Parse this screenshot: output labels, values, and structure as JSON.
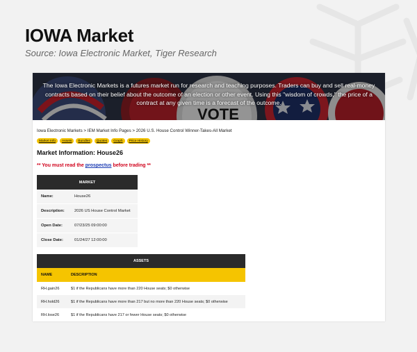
{
  "page": {
    "title": "IOWA Market",
    "subtitle": "Source: Iowa Electronic Market, Tiger Research"
  },
  "hero": {
    "text": "The Iowa Electronic Markets is a futures market run for research and teaching purposes. Traders can buy and sell real-money contracts based on their belief about the outcome of an election or other event. Using this \"wisdom of crowds,\" the price of a contract at any given time is a forecast of the outcome.",
    "vote_word": "VOTE"
  },
  "breadcrumb": "Iowa Electronic Markets > IEM Market Info Pages > 2026 U.S. House Control Winner-Takes-All Market",
  "tabs": [
    "Market Info",
    "Assets",
    "Bundles",
    "Quotes",
    "Graph",
    "Price History"
  ],
  "heading": "Market Information: House26",
  "warning": {
    "prefix": "** You must read the",
    "link": "prospectus",
    "suffix": "before trading **"
  },
  "market_table": {
    "header": "MARKET",
    "rows": [
      {
        "label": "Name:",
        "value": "House26"
      },
      {
        "label": "Description:",
        "value": "2026 US House Control Market"
      },
      {
        "label": "Open Date:",
        "value": "07/23/25 09:00:00"
      },
      {
        "label": "Close Date:",
        "value": "01/24/27 12:00:00"
      }
    ]
  },
  "assets_table": {
    "header": "ASSETS",
    "columns": [
      "NAME",
      "DESCRIPTION"
    ],
    "rows": [
      {
        "name": "RH.gain26",
        "description": "$1 if the Republicans have more than 220 House seats; $0 otherwise"
      },
      {
        "name": "RH.hold26",
        "description": "$1 if the Republicans have more than 217 but no more than 220 House seats; $0 otherwise"
      },
      {
        "name": "RH.lose26",
        "description": "$1 if the Republicans have 217 or fewer House seats; $0 otherwise"
      }
    ]
  },
  "colors": {
    "accent_yellow": "#f5c400",
    "dark_header": "#2b2b2b",
    "warning_red": "#d0021b",
    "link_blue": "#1a3bb3"
  }
}
